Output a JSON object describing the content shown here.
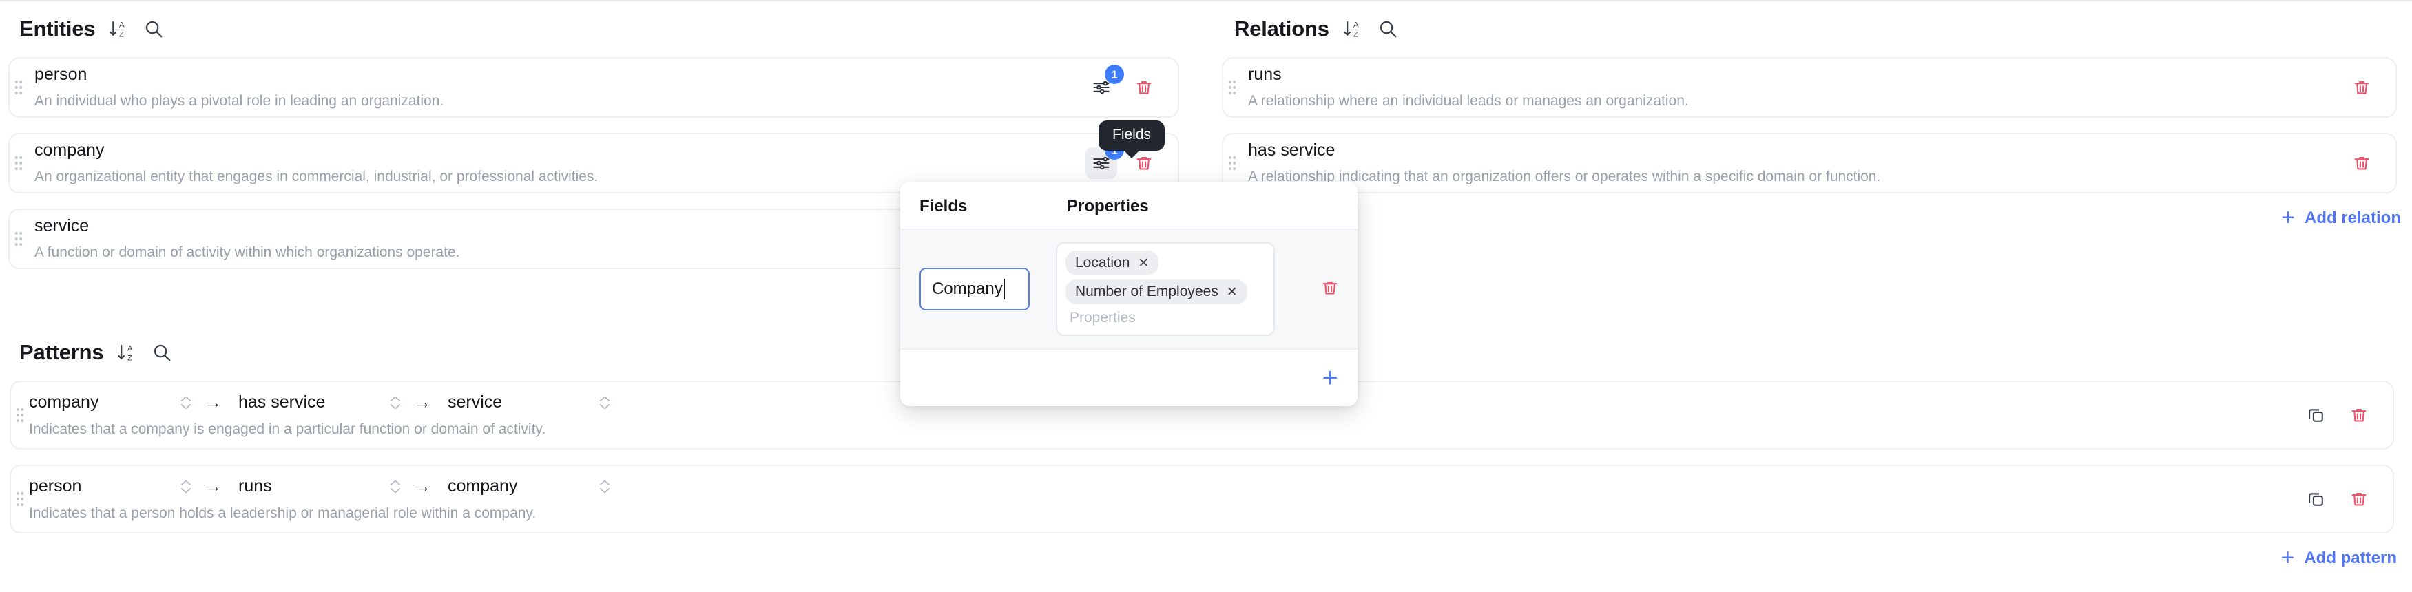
{
  "colors": {
    "accent_blue": "#5277f5",
    "badge_blue": "#3d7dfb",
    "danger_red": "#e9556d",
    "text_primary": "#14161b",
    "text_muted": "#9aa0ab",
    "tooltip_bg": "#22262e"
  },
  "entities": {
    "title": "Entities",
    "sort_icon": "sort-az-icon",
    "search_icon": "search-icon",
    "items": [
      {
        "name": "person",
        "description": "An individual who plays a pivotal role in leading an organization.",
        "fields_badge": "1"
      },
      {
        "name": "company",
        "description": "An organizational entity that engages in commercial, industrial, or professional activities.",
        "fields_badge": "1"
      },
      {
        "name": "service",
        "description": "A function or domain of activity within which organizations operate.",
        "fields_badge": ""
      }
    ]
  },
  "relations": {
    "title": "Relations",
    "sort_icon": "sort-az-icon",
    "search_icon": "search-icon",
    "add_label": "Add relation",
    "add_icon": "plus-icon",
    "items": [
      {
        "name": "runs",
        "description": "A relationship where an individual leads or manages an organization."
      },
      {
        "name": "has service",
        "description": "A relationship indicating that an organization offers or operates within a specific domain or function."
      }
    ]
  },
  "patterns": {
    "title": "Patterns",
    "sort_icon": "sort-az-icon",
    "search_icon": "search-icon",
    "add_label": "Add pattern",
    "add_icon": "plus-icon",
    "items": [
      {
        "subject": "company",
        "predicate": "has service",
        "object": "service",
        "description": "Indicates that a company is engaged in a particular function or domain of activity."
      },
      {
        "subject": "person",
        "predicate": "runs",
        "object": "company",
        "description": "Indicates that a person holds a leadership or managerial role within a company."
      }
    ]
  },
  "tooltip": {
    "label": "Fields"
  },
  "fields_popover": {
    "header_fields": "Fields",
    "header_properties": "Properties",
    "field_value": "Company",
    "properties": [
      {
        "label": "Location",
        "remove_icon": "close-icon"
      },
      {
        "label": "Number of Employees",
        "remove_icon": "close-icon"
      }
    ],
    "properties_placeholder": "Properties",
    "add_icon": "plus-icon",
    "delete_icon": "trash-icon"
  }
}
